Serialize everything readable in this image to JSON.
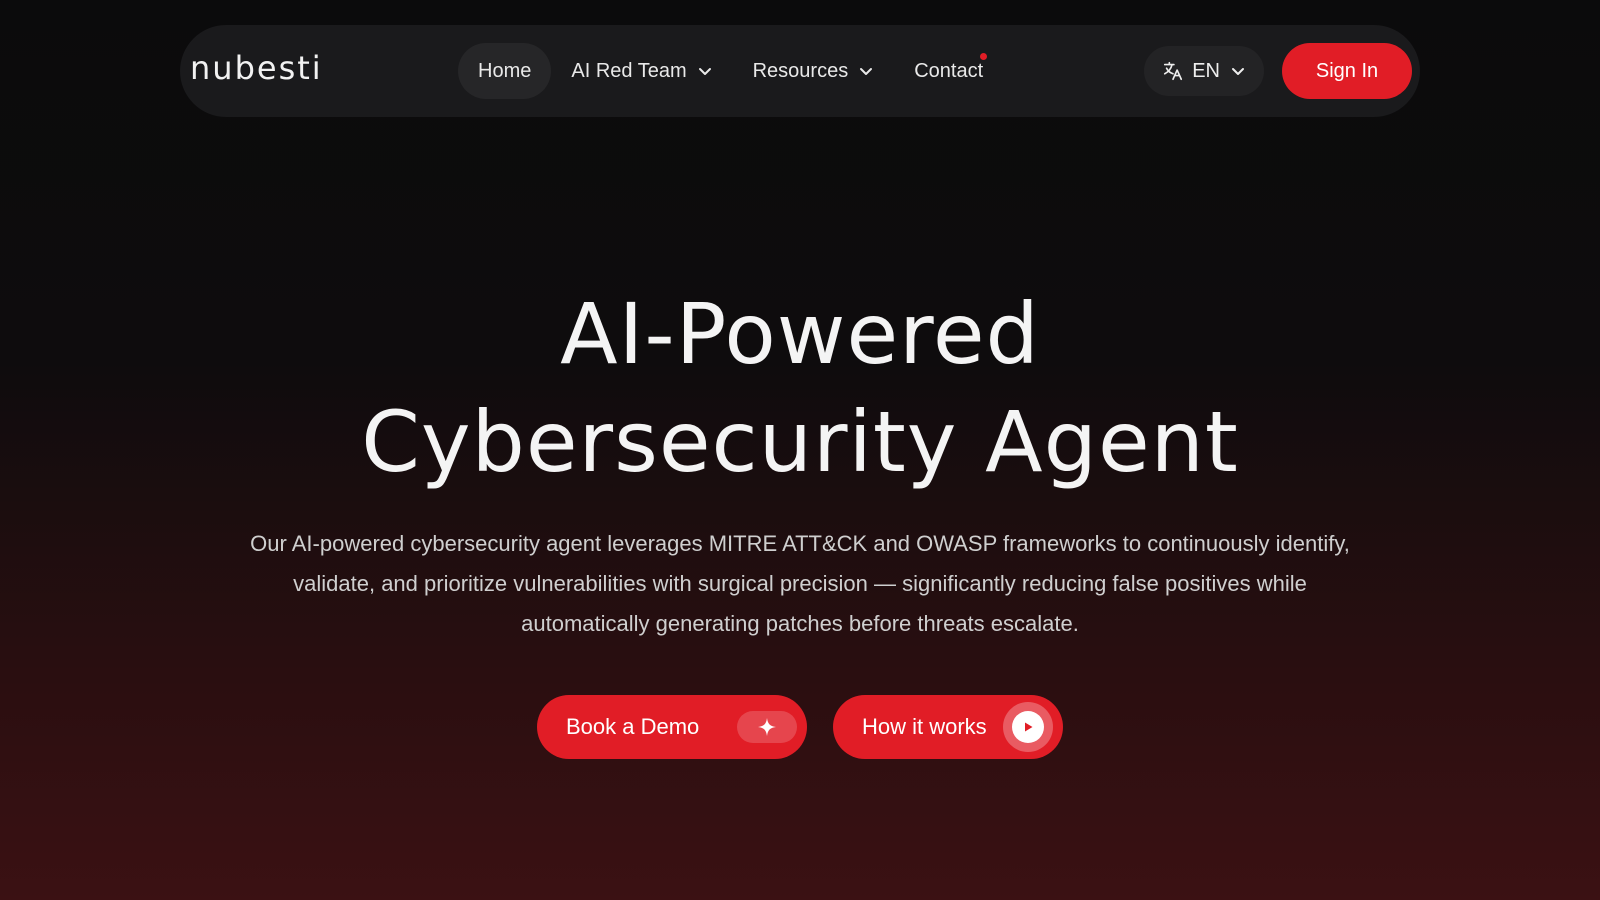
{
  "nav": {
    "logo": "nubesti",
    "items": [
      {
        "label": "Home",
        "active": true
      },
      {
        "label": "AI Red Team",
        "dropdown": true
      },
      {
        "label": "Resources",
        "dropdown": true
      },
      {
        "label": "Contact",
        "notification": true
      }
    ],
    "language": "EN",
    "sign_in": "Sign In"
  },
  "hero": {
    "title_line1": "AI-Powered",
    "title_line2": "Cybersecurity Agent",
    "description": "Our AI-powered cybersecurity agent leverages MITRE ATT&CK and OWASP frameworks to continuously identify, validate, and prioritize vulnerabilities with surgical precision — significantly reducing false positives while automatically generating patches before threats escalate.",
    "book_demo": "Book a Demo",
    "how_it_works": "How it works"
  },
  "colors": {
    "accent": "#e11d26",
    "background": "#0b0b0c",
    "nav_bg": "#1a1a1c"
  },
  "icons": {
    "language": "translate-icon",
    "dropdown": "chevron-down-icon",
    "demo": "sparkle-icon",
    "how": "play-icon"
  }
}
